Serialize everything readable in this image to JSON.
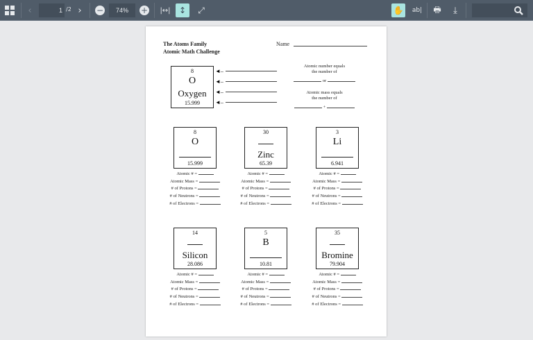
{
  "toolbar": {
    "page_current": "1",
    "page_total": "/2",
    "zoom": "74%"
  },
  "doc": {
    "title1": "The Atoms Family",
    "title2": "Atomic Math Challenge",
    "name_label": "Name",
    "example": {
      "number": "8",
      "symbol": "O",
      "name": "Oxygen",
      "mass": "15.999"
    },
    "hint1a": "Atomic number equals",
    "hint1b": "the number of",
    "or": "or",
    "hint2a": "Atomic mass equals",
    "hint2b": "the number of",
    "plus": "+",
    "cards": [
      {
        "number": "8",
        "symbol": "O",
        "name": "",
        "mass": "15.999"
      },
      {
        "number": "30",
        "symbol": "",
        "name": "Zinc",
        "mass": "65.39"
      },
      {
        "number": "3",
        "symbol": "Li",
        "name": "",
        "mass": "6.941"
      },
      {
        "number": "14",
        "symbol": "",
        "name": "Silicon",
        "mass": "28.086"
      },
      {
        "number": "5",
        "symbol": "B",
        "name": "",
        "mass": "10.81"
      },
      {
        "number": "35",
        "symbol": "",
        "name": "Bromine",
        "mass": "79.904"
      }
    ],
    "questions": [
      "Atomic # =",
      "Atomic Mass =",
      "# of Protons =",
      "# of Neutrons =",
      "# of Electrons ="
    ]
  }
}
